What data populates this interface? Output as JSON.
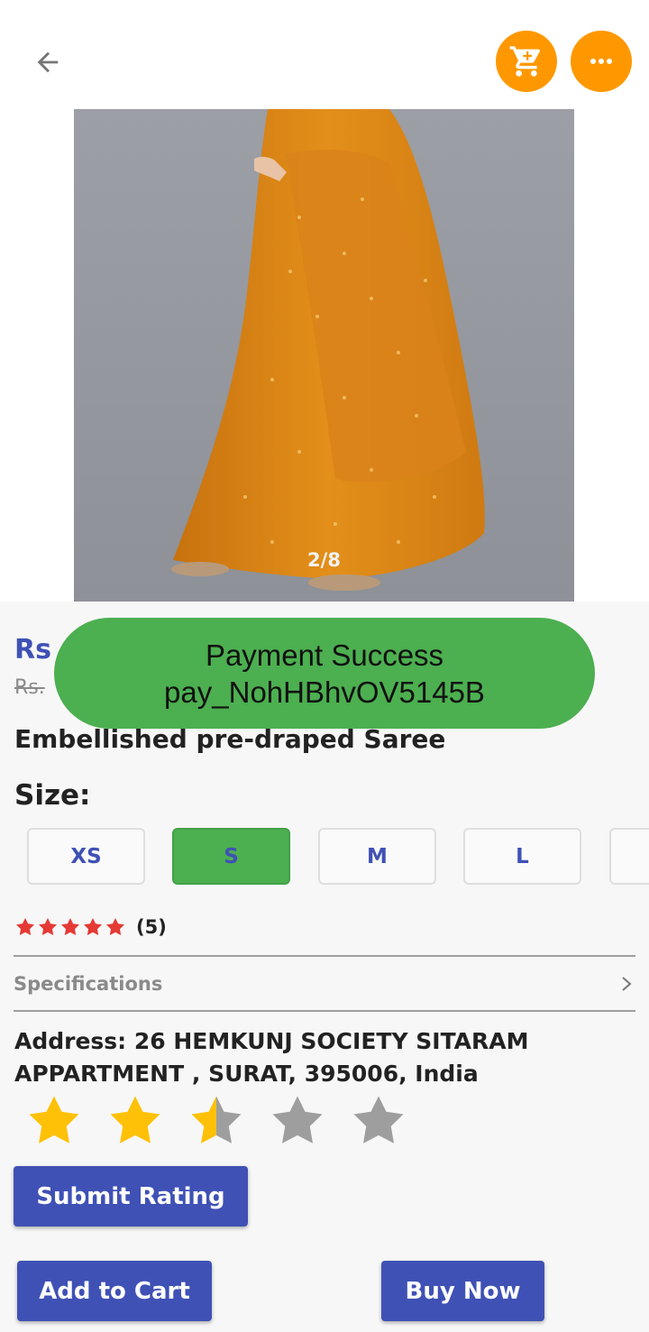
{
  "header": {
    "back_icon": "arrow-left-icon",
    "cart_icon": "shopping-cart-icon",
    "more_icon": "more-horizontal-icon",
    "accent_color": "#ff9800"
  },
  "gallery": {
    "counter": "2/8",
    "current": 2,
    "total": 8
  },
  "price": {
    "current_prefix": "Rs",
    "old_prefix": "Rs."
  },
  "toast": {
    "line1": "Payment Success",
    "line2": "pay_NohHBhvOV5145B",
    "color": "#4caf50"
  },
  "product": {
    "title": "Embellished pre-draped Saree"
  },
  "sizes": {
    "label": "Size:",
    "options": [
      "XS",
      "S",
      "M",
      "L",
      ""
    ],
    "selected": "S"
  },
  "reviews": {
    "rating": 5,
    "count_text": "(5)",
    "star_color": "#e53935"
  },
  "specifications": {
    "label": "Specifications"
  },
  "address": {
    "text": "Address: 26 HEMKUNJ SOCIETY SITARAM APPARTMENT , SURAT, 395006, India"
  },
  "user_rating": {
    "value": 2.5,
    "max": 5,
    "filled_color": "#ffc107",
    "empty_color": "#9e9e9e"
  },
  "buttons": {
    "submit_rating": "Submit Rating",
    "add_to_cart": "Add to Cart",
    "buy_now": "Buy Now",
    "color": "#3f51b5"
  }
}
